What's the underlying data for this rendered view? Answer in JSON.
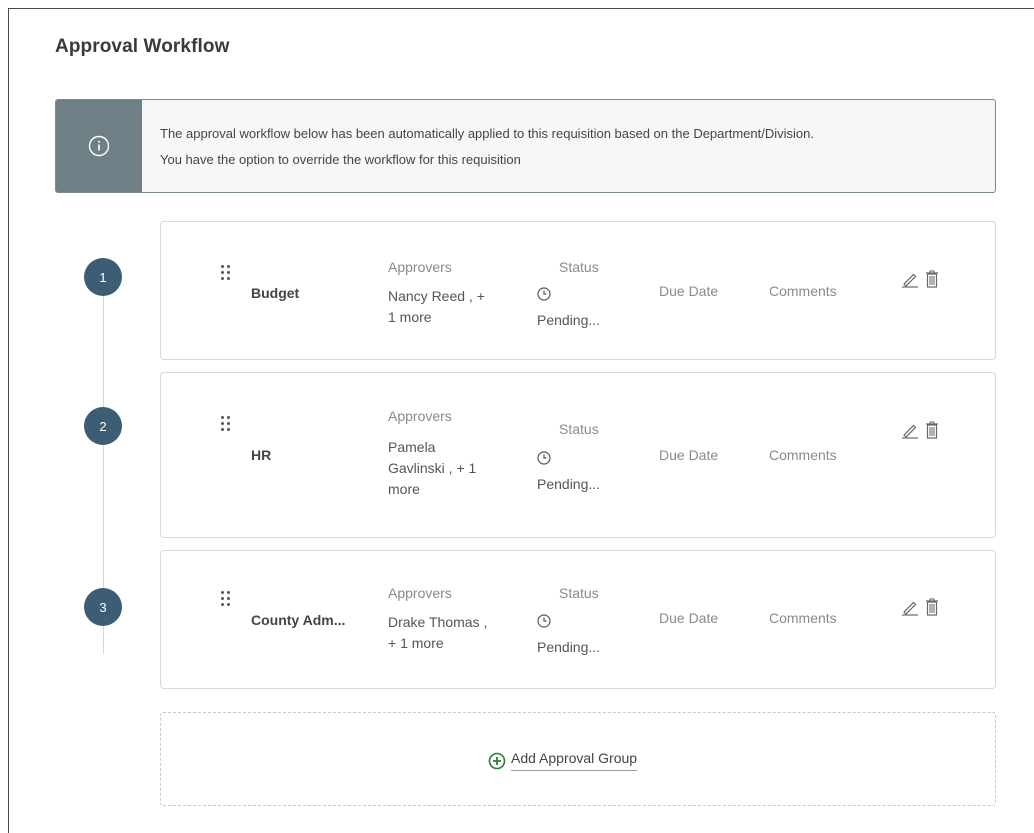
{
  "page": {
    "title": "Approval Workflow"
  },
  "info": {
    "line1": "The approval workflow below has been automatically applied to this requisition based on the Department/Division.",
    "line2": "You have the option to override the workflow for this requisition",
    "icon": "info-icon"
  },
  "labels": {
    "approvers": "Approvers",
    "status": "Status",
    "due_date": "Due Date",
    "comments": "Comments"
  },
  "groups": [
    {
      "step": "1",
      "name": "Budget",
      "approvers_line1": "Nancy Reed , +",
      "approvers_line2": "1 more",
      "approvers_line3": "",
      "status": "Pending..."
    },
    {
      "step": "2",
      "name": "HR",
      "approvers_line1": "Pamela",
      "approvers_line2": "Gavlinski , + 1",
      "approvers_line3": "more",
      "status": "Pending..."
    },
    {
      "step": "3",
      "name": "County Adm...",
      "approvers_line1": "Drake Thomas ,",
      "approvers_line2": "+ 1 more",
      "approvers_line3": "",
      "status": "Pending..."
    }
  ],
  "add_group": {
    "label": "Add Approval Group",
    "icon": "plus-circle-icon"
  },
  "colors": {
    "accent": "#3c5d74",
    "banner": "#6e7f86",
    "add_icon": "#2e7d32"
  }
}
